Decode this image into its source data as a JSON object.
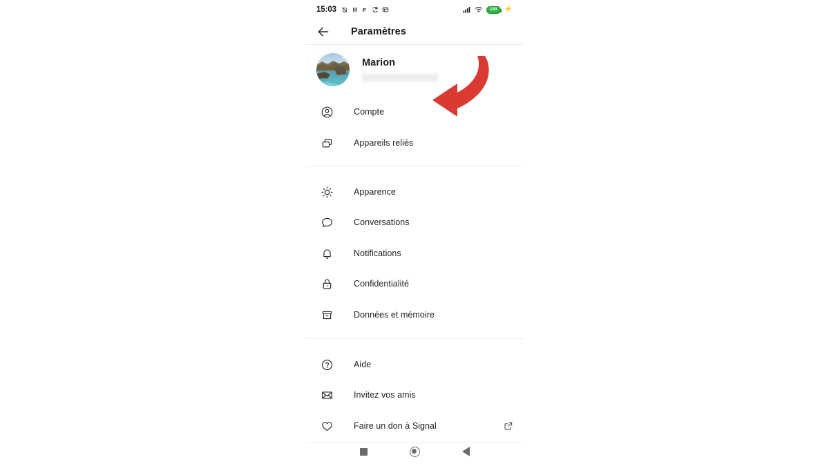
{
  "status_bar": {
    "clock": "15:03",
    "left_icons": [
      "alarm-off-icon",
      "vibrate-icon",
      "pinterest-icon",
      "sync-icon",
      "screenshot-icon"
    ],
    "right_icons": [
      "cellular-signal-icon",
      "wifi-icon",
      "battery-icon",
      "charging-bolt-icon"
    ],
    "battery_level": "100"
  },
  "app_bar": {
    "back_label": "back-arrow",
    "title": "Paramètres"
  },
  "profile": {
    "name": "Marion",
    "subtitle_redacted": "",
    "avatar_alt": "profile-photo-coastline"
  },
  "sections": [
    {
      "id": "account-section",
      "items": [
        {
          "icon": "account-circle-icon",
          "label": "Compte",
          "trailing": null
        },
        {
          "icon": "linked-devices-icon",
          "label": "Appareils reliés",
          "trailing": null
        }
      ]
    },
    {
      "id": "preferences-section",
      "items": [
        {
          "icon": "brightness-icon",
          "label": "Apparence",
          "trailing": null
        },
        {
          "icon": "chat-bubble-icon",
          "label": "Conversations",
          "trailing": null
        },
        {
          "icon": "bell-icon",
          "label": "Notifications",
          "trailing": null
        },
        {
          "icon": "lock-icon",
          "label": "Confidentialité",
          "trailing": null
        },
        {
          "icon": "archive-box-icon",
          "label": "Données et mémoire",
          "trailing": null
        }
      ]
    },
    {
      "id": "support-section",
      "items": [
        {
          "icon": "help-circle-icon",
          "label": "Aide",
          "trailing": null
        },
        {
          "icon": "envelope-icon",
          "label": "Invitez vos amis",
          "trailing": null
        },
        {
          "icon": "heart-icon",
          "label": "Faire un don à Signal",
          "trailing": "external-link-icon"
        }
      ]
    }
  ],
  "nav_bar": {
    "recents_label": "recents-square-button",
    "home_label": "home-circle-button",
    "back_label": "back-triangle-button"
  },
  "annotation": {
    "type": "curved-arrow",
    "color": "#d93a31",
    "points_to": "Compte"
  },
  "colors": {
    "background": "#ffffff",
    "text_primary": "#1b1b1b",
    "text_secondary": "#232323",
    "divider": "#ededee",
    "annotation_red": "#d93a31",
    "battery_green": "#2fb344",
    "nav_gray": "#6b6b6b"
  }
}
